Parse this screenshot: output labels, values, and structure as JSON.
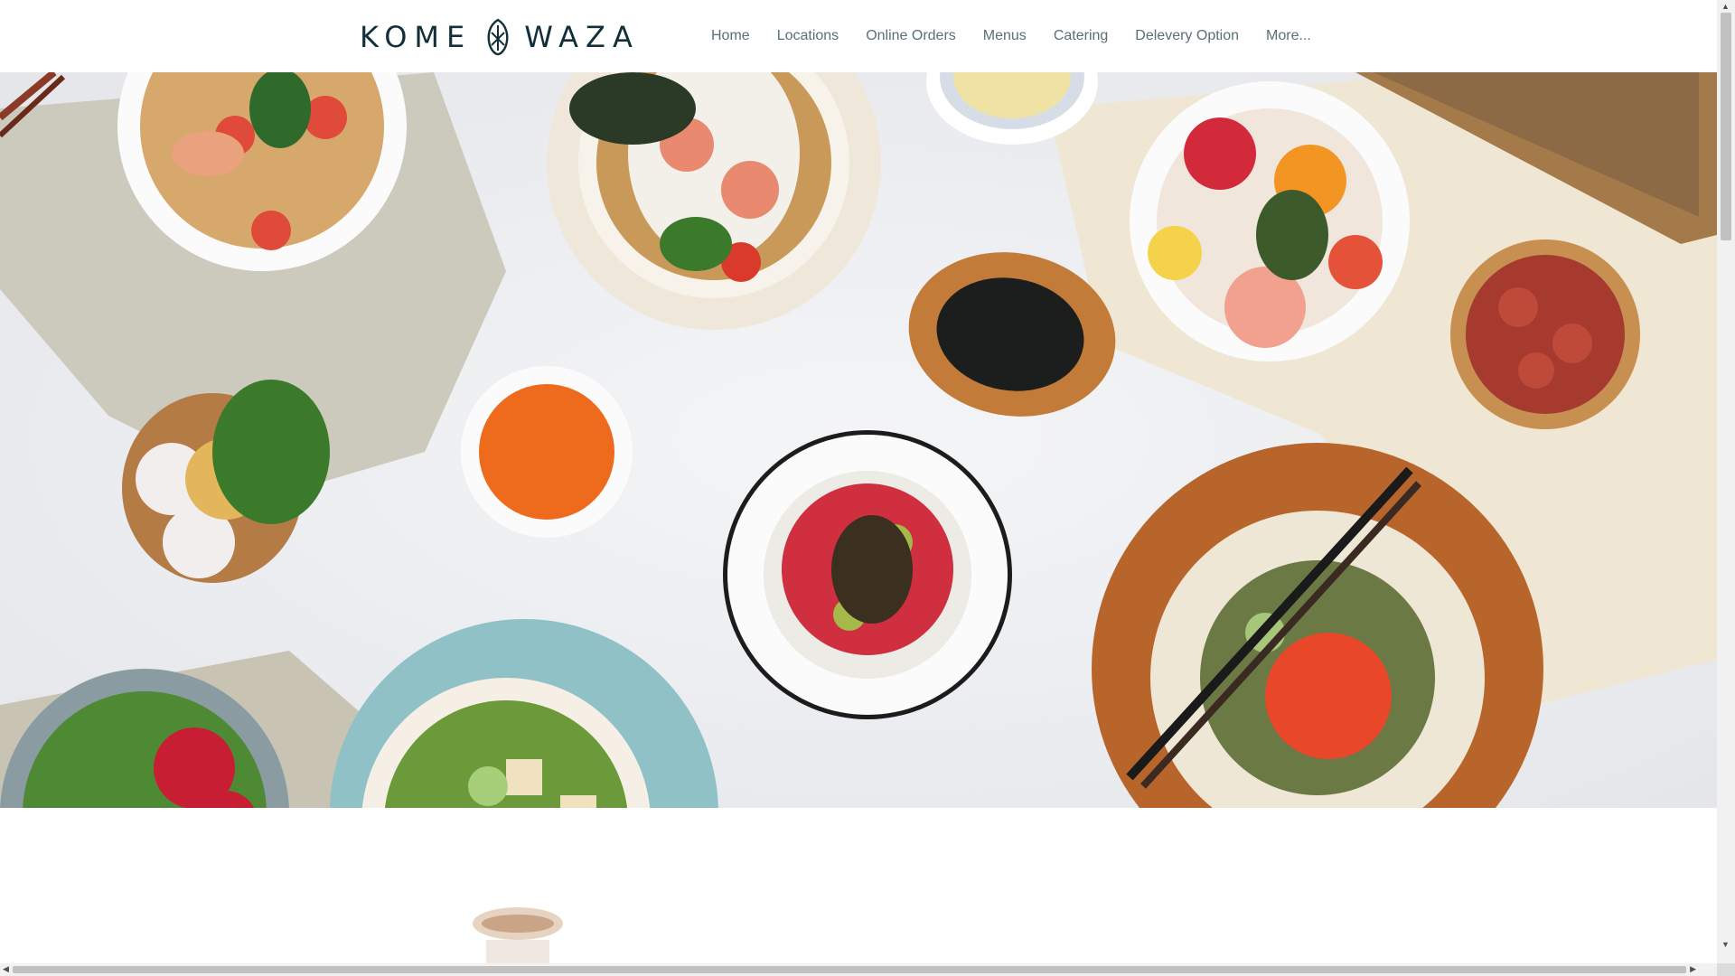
{
  "brand": {
    "left": "KOME",
    "right": "WAZA"
  },
  "nav": {
    "items": [
      {
        "label": "Home"
      },
      {
        "label": "Locations"
      },
      {
        "label": "Online Orders"
      },
      {
        "label": "Menus"
      },
      {
        "label": "Catering"
      },
      {
        "label": "Delevery Option"
      },
      {
        "label": "More..."
      }
    ]
  },
  "colors": {
    "brand_text": "#13303a",
    "nav_text": "#5b7073"
  },
  "icons": {
    "logo": "leaf-emblem-icon"
  }
}
